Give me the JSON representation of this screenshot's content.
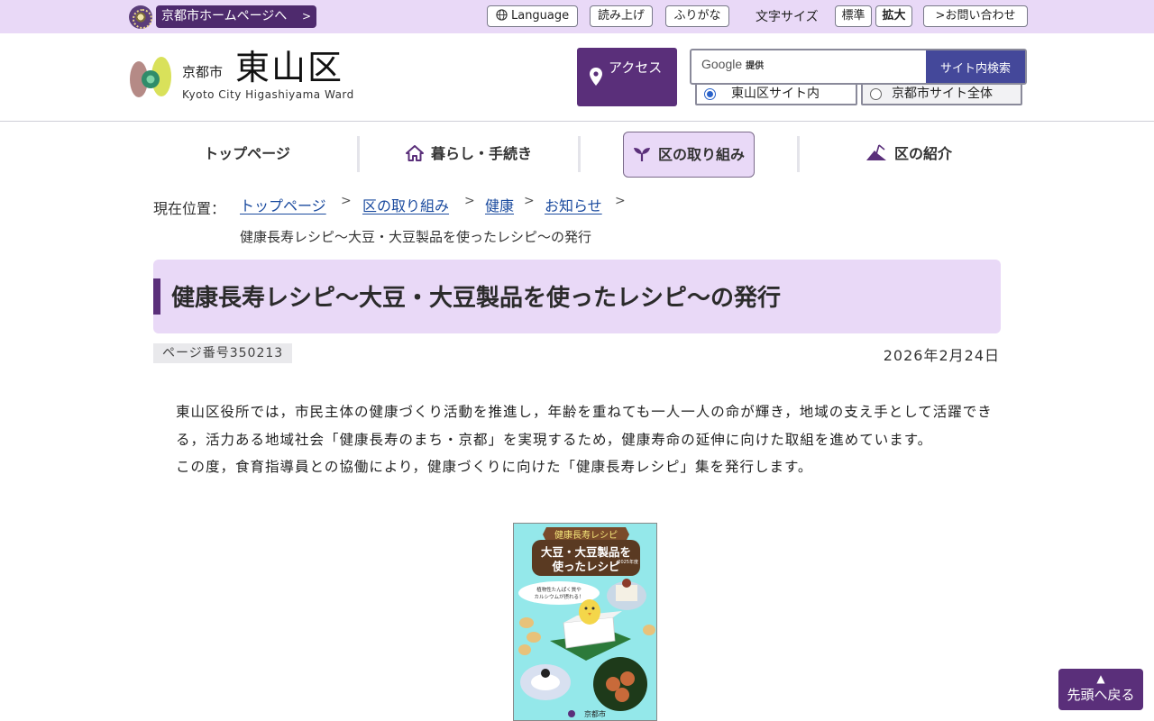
{
  "topbar": {
    "city_link": "京都市ホームページへ",
    "language": "Language",
    "read_aloud": "読み上げ",
    "furigana": "ふりがな",
    "font_size_label": "文字サイズ",
    "font_standard": "標準",
    "font_large": "拡大",
    "contact": "お問い合わせ"
  },
  "header": {
    "logo_city": "京都市",
    "logo_ward": "東山区",
    "logo_en": "Kyoto City Higashiyama Ward",
    "access_label": "アクセス",
    "search": {
      "google_label": "Google",
      "google_sub": "提供",
      "button": "サイト内検索",
      "option_ward": "東山区サイト内",
      "option_city": "京都市サイト全体",
      "selected": "東山区サイト内"
    }
  },
  "nav": {
    "items": [
      {
        "label": "トップページ",
        "icon": "none"
      },
      {
        "label": "暮らし・手続き",
        "icon": "house-icon"
      },
      {
        "label": "区の取り組み",
        "icon": "sprout-icon"
      },
      {
        "label": "区の紹介",
        "icon": "mountain-icon"
      }
    ],
    "active": "区の取り組み"
  },
  "breadcrumb": {
    "label": "現在位置：",
    "links": [
      "トップページ",
      "区の取り組み",
      "健康",
      "お知らせ"
    ],
    "current": "健康長寿レシピ～大豆・大豆製品を使ったレシピ～の発行"
  },
  "page": {
    "title": "健康長寿レシピ～大豆・大豆製品を使ったレシピ～の発行",
    "page_number": "ページ番号350213",
    "date": "2026年2月24日",
    "paragraphs": [
      "東山区役所では，市民主体の健康づくり活動を推進し，年齢を重ねても一人一人の命が輝き，地域の支え手として活躍できる，活力ある地域社会「健康長寿のまち・京都」を実現するため，健康寿命の延伸に向けた取組を進めています。",
      "この度，食育指導員との協働により，健康づくりに向けた「健康長寿レシピ」集を発行します。"
    ]
  },
  "leaflet": {
    "banner": "健康長寿レシピ",
    "title_line1": "大豆・大豆製品を",
    "title_line2": "使ったレシピ",
    "year": "2025年度",
    "bubble_line1": "植物性たんぱく質や",
    "bubble_line2": "カルシウムが摂れる！",
    "footer_city": "京都市"
  },
  "to_top": "先頭へ戻る",
  "colors": {
    "accent_purple": "#5a2f7a",
    "light_purple": "#e9d9f7",
    "link_blue": "#1a4a9e",
    "search_blue": "#44489a"
  }
}
